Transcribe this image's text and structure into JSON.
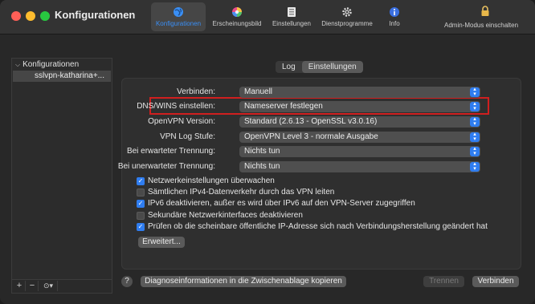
{
  "window": {
    "title": "Konfigurationen"
  },
  "toolbar": {
    "items": [
      {
        "label": "Konfigurationen",
        "icon": "globe-icon",
        "active": true
      },
      {
        "label": "Erscheinungsbild",
        "icon": "color-wheel-icon"
      },
      {
        "label": "Einstellungen",
        "icon": "settings-panel-icon"
      },
      {
        "label": "Dienstprogramme",
        "icon": "gear-icon"
      },
      {
        "label": "Info",
        "icon": "info-icon"
      }
    ],
    "admin_label": "Admin-Modus einschalten",
    "accent": "#3a8ff5"
  },
  "sidebar": {
    "header": "Konfigurationen",
    "items": [
      {
        "label": "sslvpn-katharina+..."
      }
    ],
    "bottom": {
      "add": "+",
      "remove": "−",
      "more": "⊙▾"
    }
  },
  "tabs": [
    {
      "label": "Log"
    },
    {
      "label": "Einstellungen",
      "selected": true
    }
  ],
  "settings": {
    "rows": [
      {
        "label": "Verbinden:",
        "value": "Manuell"
      },
      {
        "label": "DNS/WINS einstellen:",
        "value": "Nameserver festlegen",
        "highlighted": true
      },
      {
        "label": "OpenVPN Version:",
        "value": "Standard (2.6.13 - OpenSSL v3.0.16)"
      },
      {
        "label": "VPN Log Stufe:",
        "value": "OpenVPN Level 3 - normale Ausgabe"
      },
      {
        "label": "Bei erwarteter Trennung:",
        "value": "Nichts tun"
      },
      {
        "label": "Bei unerwarteter Trennung:",
        "value": "Nichts tun"
      }
    ],
    "checkboxes": [
      {
        "label": "Netzwerkeinstellungen überwachen",
        "checked": true
      },
      {
        "label": "Sämtlichen IPv4-Datenverkehr durch das VPN leiten",
        "checked": false
      },
      {
        "label": "IPv6 deaktivieren, außer es wird über IPv6 auf den VPN-Server zugegriffen",
        "checked": true
      },
      {
        "label": "Sekundäre Netzwerkinterfaces deaktivieren",
        "checked": false
      },
      {
        "label": "Prüfen ob die scheinbare öffentliche IP-Adresse sich nach Verbindungsherstellung geändert hat",
        "checked": true
      }
    ],
    "advanced_button": "Erweitert..."
  },
  "footer": {
    "help": "?",
    "diagnostics_button": "Diagnoseinformationen in die Zwischenablage kopieren",
    "disconnect_button": "Trennen",
    "connect_button": "Verbinden"
  },
  "colors": {
    "highlight": "#d01f1f",
    "checkbox": "#2f7df0"
  }
}
